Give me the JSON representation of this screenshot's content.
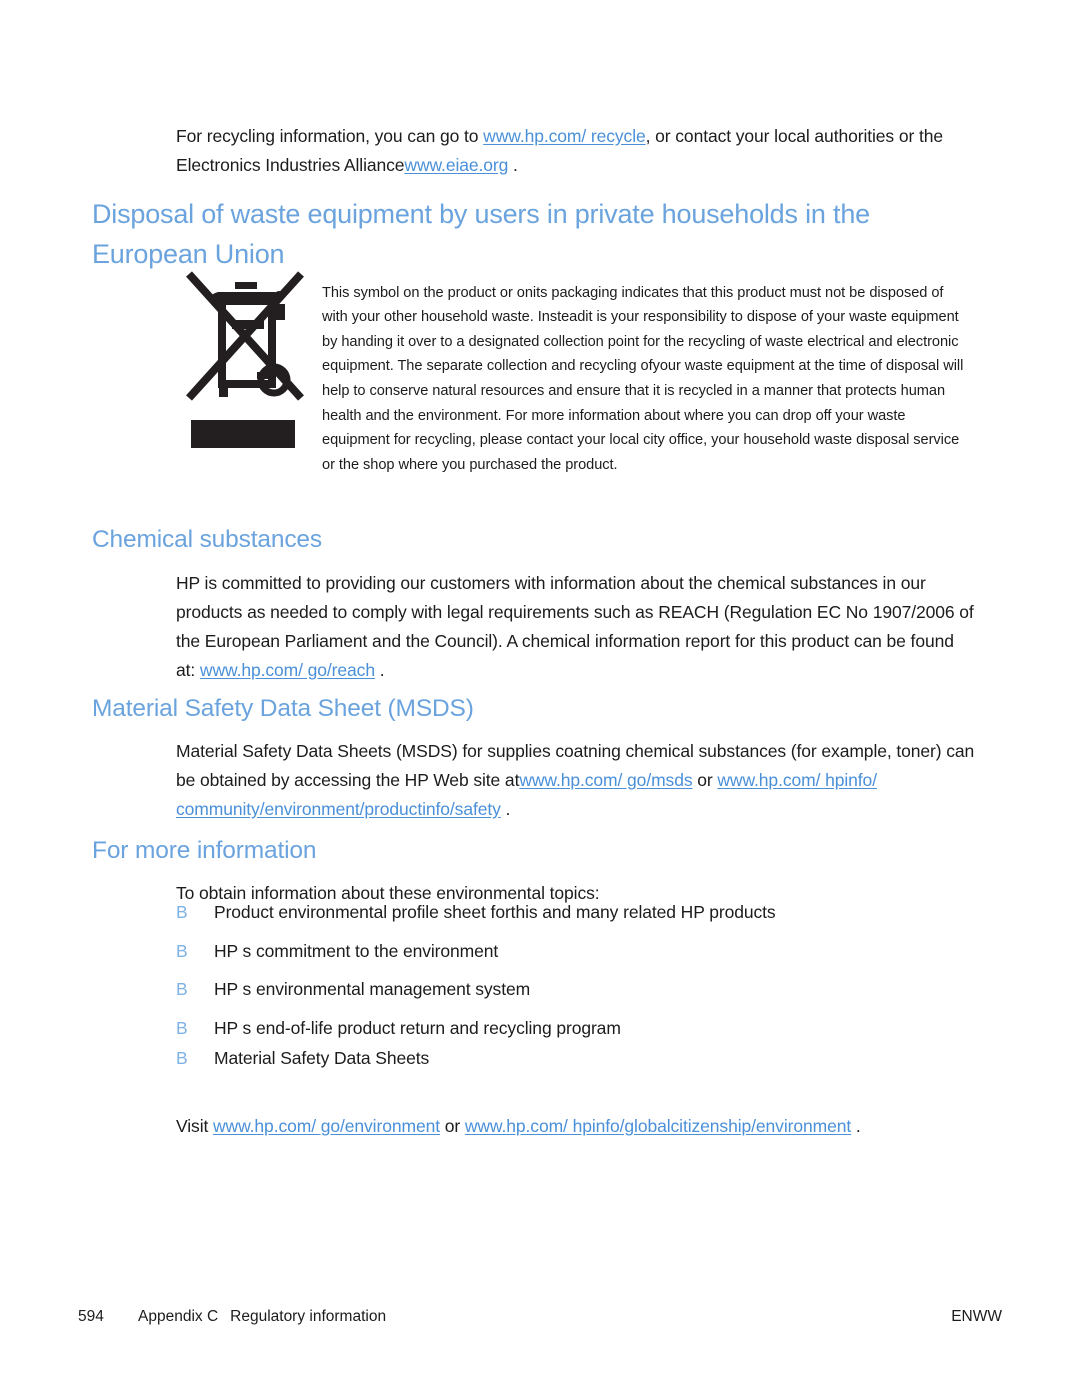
{
  "colors": {
    "heading_blue": "#6aa3dd",
    "link_blue": "#4a90d9",
    "body_text": "#1c1c1c",
    "bullet_blue": "#7fb2e5",
    "symbol_black": "#231f20",
    "page_background": "#ffffff"
  },
  "intro": {
    "part1": "For recycling information, you can go to ",
    "link1": "www.hp.com/ recycle",
    "part2": ", or contact your local authorities or the Electronics Industries Alliance",
    "link2": "www.eiae.org",
    "part3": " ."
  },
  "disposal_section": {
    "heading": "Disposal of waste equipment by users in private households in the European Union",
    "symbol_name": "crossed-out-wheeled-bin",
    "paragraph": "This symbol on the product or onits packaging indicates that this product must not be disposed of with your other household waste. Insteadit is your responsibility to dispose of your waste equipment by handing it over to a designated collection point for the recycling of waste electrical and electronic equipment. The separate collection and recycling ofyour waste equipment at the time of disposal will help to conserve natural resources and ensure that it is recycled in a manner that protects human health and the environment. For more information about where you can drop off your waste equipment for recycling, please contact your local city office, your household waste disposal service or the shop where you purchased the product."
  },
  "chemical_section": {
    "heading": "Chemical substances",
    "part1": "HP is committed to providing our customers with information about the chemical substances in our products as needed to comply with legal requirements such as REACH (Regulation EC No 1907/2006 of the European Parliament and the Council). A chemical information report for this product can be found at: ",
    "link": "www.hp.com/ go/reach",
    "part2": " ."
  },
  "msds_section": {
    "heading": "Material Safety Data Sheet (MSDS)",
    "part1": "Material Safety Data Sheets (MSDS) for supplies coatning chemical substances (for example, toner) can be obtained by accessing the HP Web site at",
    "link1": "www.hp.com/ go/msds",
    "part2": " or ",
    "link2": "www.hp.com/ hpinfo/ community/environment/productinfo/safety",
    "part3": " ."
  },
  "more_information_section": {
    "heading": "For more information",
    "intro": "To obtain information about these environmental topics:",
    "bullet_marker": "B",
    "bullets": [
      "Product environmental profile sheet forthis and many related HP products",
      "HP s commitment to the environment",
      "HP s environmental management system",
      "HP s end-of-life product return and recycling program",
      "Material Safety Data Sheets"
    ],
    "visit": {
      "part1": "Visit ",
      "link1": "www.hp.com/ go/environment",
      "part2": " or ",
      "link2": "www.hp.com/ hpinfo/globalcitizenship/environment",
      "part3": " ."
    }
  },
  "footer": {
    "page_number": "594",
    "appendix": "Appendix C",
    "chapter": "Regulatory information",
    "language_code": "ENWW"
  }
}
